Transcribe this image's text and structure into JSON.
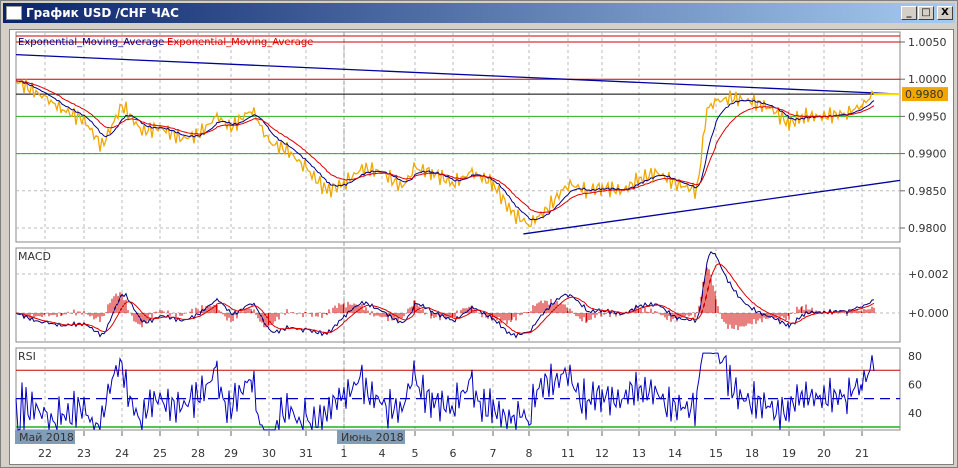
{
  "window": {
    "title": "График USD /CHF ЧАС",
    "buttons": [
      "_",
      "□",
      "X"
    ]
  },
  "legend": {
    "ema1": "Exponential_Moving_Average",
    "ema2": "Exponential_Moving_Average"
  },
  "colors": {
    "price": "#f0a800",
    "ema_fast": "#00008b",
    "ema_slow": "#e00000",
    "trend": "#0000a0",
    "level_red": "#cc0000",
    "level_green": "#20b020",
    "hist": "#d00000"
  },
  "chart_data": [
    {
      "type": "line",
      "title": "USD/CHF H1",
      "price_axis": [
        "1.0050",
        "1.0000",
        "0.9950",
        "0.9900",
        "0.9850",
        "0.9800"
      ],
      "ylim": [
        0.979,
        1.0065
      ],
      "current_price": "0.9980",
      "levels": {
        "red": [
          1.005,
          1.0
        ],
        "black": [
          0.998
        ],
        "green": [
          0.995,
          0.99
        ]
      },
      "trendlines": [
        {
          "from": [
            0,
            1.0033
          ],
          "to": [
            1,
            0.998
          ]
        },
        {
          "from": [
            0.574,
            0.9792
          ],
          "to": [
            1,
            0.9864
          ]
        }
      ],
      "x": [
        0,
        29,
        46,
        68,
        86,
        106,
        126,
        144,
        166,
        182,
        201,
        215,
        236,
        253,
        271,
        290,
        311,
        328,
        346,
        366,
        386,
        399,
        416,
        437,
        456,
        477,
        496,
        513,
        531,
        552,
        571,
        586,
        606,
        623,
        641,
        659,
        681,
        691,
        700,
        716,
        736,
        756,
        773,
        786,
        808,
        831,
        846,
        858
      ],
      "price": [
        0.9998,
        0.9975,
        0.996,
        0.9945,
        0.991,
        0.9965,
        0.993,
        0.9935,
        0.992,
        0.9925,
        0.995,
        0.9935,
        0.996,
        0.9915,
        0.9905,
        0.988,
        0.985,
        0.986,
        0.988,
        0.9875,
        0.9855,
        0.988,
        0.9875,
        0.986,
        0.9875,
        0.986,
        0.982,
        0.9805,
        0.9825,
        0.986,
        0.985,
        0.9855,
        0.985,
        0.9865,
        0.9875,
        0.986,
        0.985,
        0.996,
        0.997,
        0.9975,
        0.997,
        0.996,
        0.994,
        0.995,
        0.995,
        0.9955,
        0.9965,
        0.998
      ]
    },
    {
      "type": "line",
      "title": "MACD",
      "axis": [
        "+0.002",
        "+0.000"
      ]
    },
    {
      "type": "line",
      "title": "RSI",
      "axis": [
        "80",
        "60",
        "40"
      ],
      "levels": [
        70,
        50,
        30
      ]
    }
  ],
  "dates": {
    "months": [
      "Май 2018",
      "Июнь 2018"
    ],
    "ticks": [
      "22",
      "23",
      "24",
      "25",
      "28",
      "29",
      "30",
      "31",
      "1",
      "4",
      "5",
      "6",
      "7",
      "8",
      "11",
      "12",
      "13",
      "14",
      "15",
      "18",
      "19",
      "20",
      "21"
    ]
  }
}
